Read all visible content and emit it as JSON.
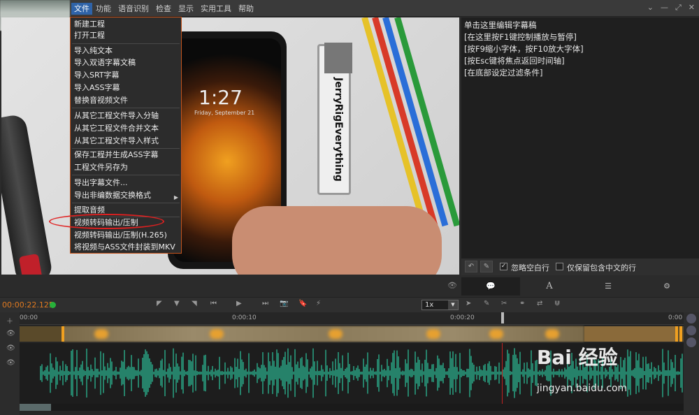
{
  "menubar": {
    "items": [
      {
        "label": "文件",
        "active": true
      },
      {
        "label": "功能"
      },
      {
        "label": "语音识别"
      },
      {
        "label": "检查"
      },
      {
        "label": "显示"
      },
      {
        "label": "实用工具"
      },
      {
        "label": "帮助"
      }
    ],
    "window_controls": [
      "chevron-down-icon",
      "minimize-icon",
      "maximize-icon",
      "close-icon"
    ]
  },
  "file_menu": {
    "items": [
      "新建工程",
      "打开工程",
      "导入纯文本",
      "导入双语字幕文稿",
      "导入SRT字幕",
      "导入ASS字幕",
      "替换音视频文件",
      "从其它工程文件导入分轴",
      "从其它工程文件合并文本",
      "从其它工程文件导入样式",
      "保存工程并生成ASS字幕",
      "工程文件另存为",
      "导出字幕文件...",
      "导出非编数据交换格式",
      "提取音频",
      "视频转码输出/压制",
      "视频转码输出/压制(H.265)",
      "将视频与ASS文件封装到MKV"
    ],
    "highlighted_item": "视频转码输出/压制"
  },
  "video": {
    "phone_time": "1:27",
    "phone_date": "Friday, September 21",
    "tool_text": "JerryRigEverything"
  },
  "subtitle_panel": {
    "lines": [
      "单击这里编辑字幕稿",
      "[在这里按F1键控制播放与暂停]",
      "[按F9缩小字体，按F10放大字体]",
      "[按Esc键将焦点返回时间轴]",
      "[在底部设定过滤条件]"
    ],
    "toolbar": {
      "ignore_empty_label": "忽略空白行",
      "ignore_empty_checked": true,
      "chinese_only_label": "仅保留包含中文的行",
      "chinese_only_checked": false
    },
    "tabs": [
      "speech-bubble-icon",
      "font-icon",
      "list-icon",
      "gear-icon"
    ]
  },
  "playback": {
    "time": "00:00:22.125",
    "speed": "1x"
  },
  "timeline": {
    "ruler_labels": [
      "00:00",
      "0:00:10",
      "0:00:20",
      "0:00"
    ],
    "playhead_time": "0:00:22.125"
  },
  "watermark": {
    "logo": "Bai 经验",
    "url": "jingyan.baidu.com"
  },
  "colors": {
    "accent": "#2f63a8",
    "menu_border": "#c6541c",
    "time_color": "#e07a20",
    "waveform": "#2aa585",
    "subtitle_block": "#e6a030",
    "highlight_ring": "#e02020"
  }
}
